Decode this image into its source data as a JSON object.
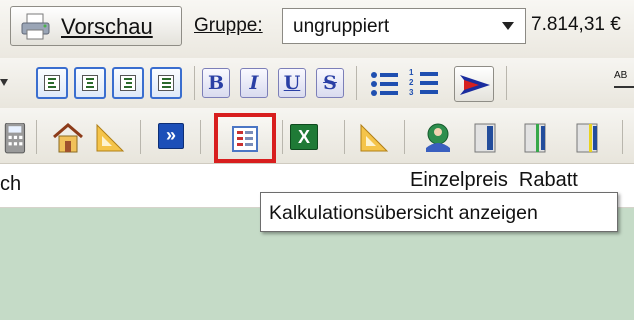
{
  "toolbar_top": {
    "preview_label": "Vorschau",
    "group_label": "Gruppe:",
    "group_value": "ungruppiert",
    "amount": "7.814,31 €"
  },
  "toolbar_format": {
    "bold": "B",
    "italic": "I",
    "underline": "U",
    "strike": "S",
    "list_numbers": "1 2 3",
    "overflow_text": "AB"
  },
  "toolbar_tools": {
    "overview_tooltip": "Kalkulationsübersicht anzeigen",
    "forward_symbol": "»",
    "excel_symbol": "X"
  },
  "header_row": {
    "left_fragment": "ch",
    "right_fragment": "Einzelpreis  Rabatt"
  },
  "colors": {
    "highlight_box": "#d81e1e",
    "content_background": "#c5dbc7",
    "toolbar_button_border": "#3a6ecf"
  }
}
